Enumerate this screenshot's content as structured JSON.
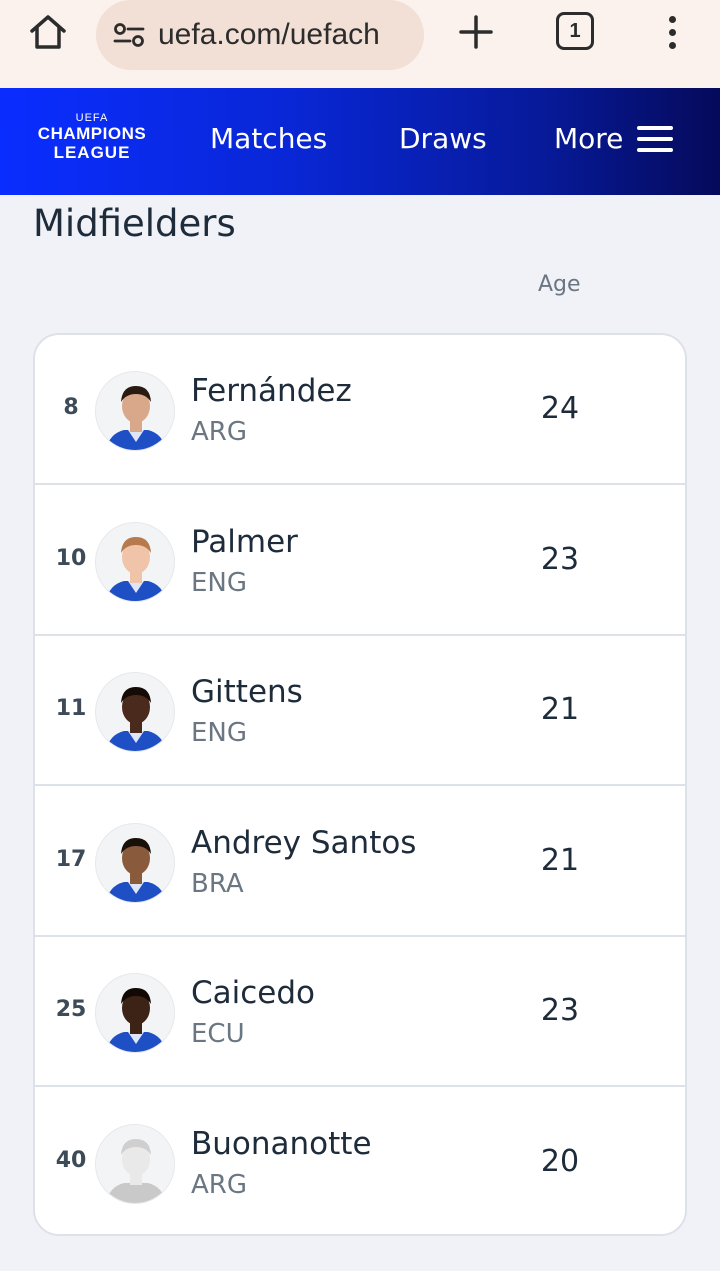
{
  "browser": {
    "url": "uefa.com/uefach",
    "tab_count": "1"
  },
  "nav": {
    "logo_top": "UEFA",
    "logo_line1": "CHAMPIONS",
    "logo_line2": "LEAGUE",
    "items": [
      "Matches",
      "Draws",
      "More"
    ]
  },
  "section": {
    "title": "Midfielders",
    "age_header": "Age"
  },
  "players": [
    {
      "number": "8",
      "name": "Fernández",
      "nationality": "ARG",
      "age": "24",
      "skin": "#d9a78a",
      "hair": "#2a1b12"
    },
    {
      "number": "10",
      "name": "Palmer",
      "nationality": "ENG",
      "age": "23",
      "skin": "#f0c4a8",
      "hair": "#b77a4c"
    },
    {
      "number": "11",
      "name": "Gittens",
      "nationality": "ENG",
      "age": "21",
      "skin": "#4a2a1c",
      "hair": "#150b06"
    },
    {
      "number": "17",
      "name": "Andrey Santos",
      "nationality": "BRA",
      "age": "21",
      "skin": "#8a5a3c",
      "hair": "#1a100a"
    },
    {
      "number": "25",
      "name": "Caicedo",
      "nationality": "ECU",
      "age": "23",
      "skin": "#3d2216",
      "hair": "#120905"
    },
    {
      "number": "40",
      "name": "Buonanotte",
      "nationality": "ARG",
      "age": "20",
      "skin": "#e9e9e9",
      "hair": "#cfcfcf",
      "placeholder": true
    }
  ],
  "colors": {
    "nav_gradient_start": "#0a2dff",
    "nav_gradient_end": "#050a5a",
    "kit_blue": "#1e4fc4"
  }
}
